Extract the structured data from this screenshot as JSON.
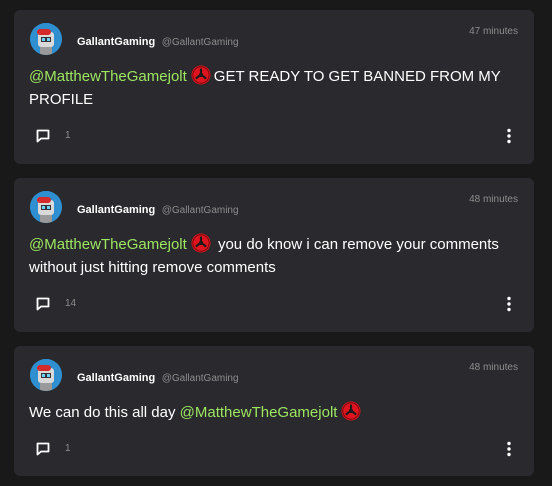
{
  "posts": [
    {
      "display_name": "GallantGaming",
      "handle": "@GallantGaming",
      "time": "47 minutes",
      "mention": "@MatthewTheGamejolt",
      "text_before": "",
      "text_after": "GET READY TO GET BANNED FROM MY PROFILE",
      "comment_count": "1"
    },
    {
      "display_name": "GallantGaming",
      "handle": "@GallantGaming",
      "time": "48 minutes",
      "mention": "@MatthewTheGamejolt",
      "text_before": "",
      "text_after": "you do know i can remove your comments without just hitting remove comments",
      "comment_count": "14"
    },
    {
      "display_name": "GallantGaming",
      "handle": "@GallantGaming",
      "time": "48 minutes",
      "mention": "@MatthewTheGamejolt",
      "text_before": "We can do this all day",
      "text_after": "",
      "comment_count": "1"
    }
  ],
  "icons": {
    "avatar": "robot-avatar-icon",
    "verified": "gamejolt-badge-icon",
    "comment": "comment-bubble-icon",
    "more": "more-vertical-icon"
  },
  "colors": {
    "background": "#191919",
    "card": "#2a2a2e",
    "mention": "#9ce660",
    "muted": "#8d8d8d",
    "badge": "#e0141e"
  }
}
